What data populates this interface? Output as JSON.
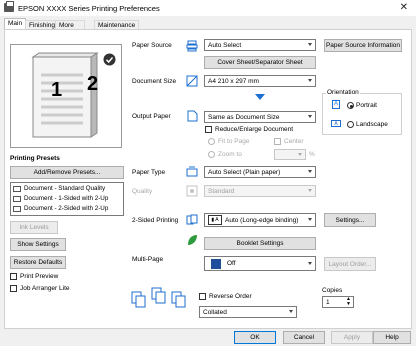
{
  "window": {
    "title": "EPSON XXXX Series Printing Preferences"
  },
  "tabs": [
    "Main",
    "Finishing",
    "More Options",
    "Maintenance"
  ],
  "preview": {
    "page1": "1",
    "page2": "2"
  },
  "presets": {
    "heading": "Printing Presets",
    "add_remove": "Add/Remove Presets...",
    "items": [
      "Document - Standard Quality",
      "Document - 1-Sided with 2-Up",
      "Document - 2-Sided with 2-Up"
    ],
    "ink_levels": "Ink Levels",
    "show_settings": "Show Settings",
    "restore_defaults": "Restore Defaults",
    "print_preview": "Print Preview",
    "job_arranger": "Job Arranger Lite"
  },
  "paper_source": {
    "label": "Paper Source",
    "value": "Auto Select",
    "info_button": "Paper Source Information",
    "cover_button": "Cover Sheet/Separator Sheet"
  },
  "document_size": {
    "label": "Document Size",
    "value": "A4 210 x 297 mm"
  },
  "orientation": {
    "label": "Orientation",
    "portrait": "Portrait",
    "landscape": "Landscape",
    "selected": "Portrait"
  },
  "output_paper": {
    "label": "Output Paper",
    "value": "Same as Document Size",
    "reduce_enlarge": "Reduce/Enlarge Document",
    "fit_to_page": "Fit to Page",
    "center": "Center",
    "zoom_to": "Zoom to",
    "percent": "%"
  },
  "paper_type": {
    "label": "Paper Type",
    "value": "Auto Select (Plain paper)"
  },
  "quality": {
    "label": "Quality",
    "value": "Standard"
  },
  "two_sided": {
    "label": "2-Sided Printing",
    "value": "Auto (Long-edge binding)",
    "settings": "Settings...",
    "booklet": "Booklet Settings"
  },
  "multi_page": {
    "label": "Multi-Page",
    "value": "Off",
    "layout_order": "Layout Order..."
  },
  "reverse_order": {
    "label": "Reverse Order",
    "collate_value": "Collated"
  },
  "copies": {
    "label": "Copies",
    "value": "1"
  },
  "footer": {
    "ok": "OK",
    "cancel": "Cancel",
    "apply": "Apply",
    "help": "Help"
  },
  "colors": {
    "accent_blue": "#1e6fd0",
    "green": "#2e9a3e",
    "disabled": "#a0a0a0"
  }
}
